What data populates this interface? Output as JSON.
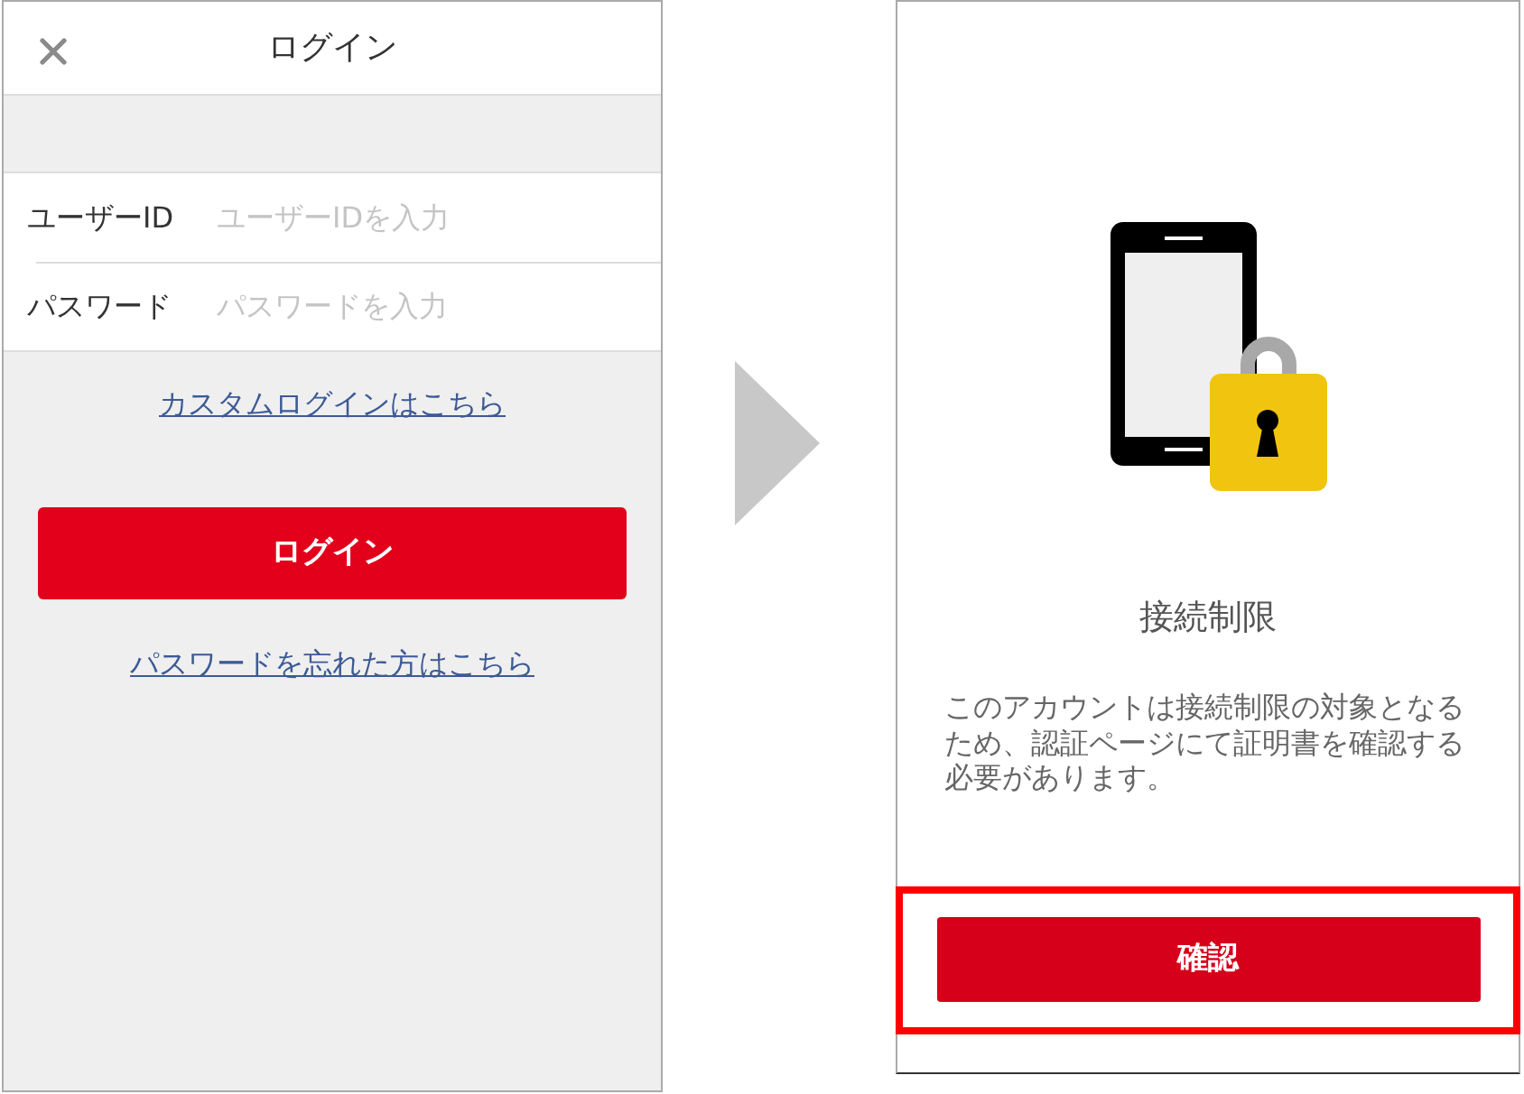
{
  "login_screen": {
    "title": "ログイン",
    "fields": [
      {
        "label": "ユーザーID",
        "placeholder": "ユーザーIDを入力"
      },
      {
        "label": "パスワード",
        "placeholder": "パスワードを入力"
      }
    ],
    "custom_login_link": "カスタムログインはこちら",
    "login_button": "ログイン",
    "forgot_password_link": "パスワードを忘れた方はこちら"
  },
  "restriction_screen": {
    "title": "接続制限",
    "message": "このアカウントは接続制限の対象となるため、認証ページにて証明書を確認する必要があります。",
    "confirm_button": {
      "label": "確認",
      "highlighted": true
    }
  }
}
